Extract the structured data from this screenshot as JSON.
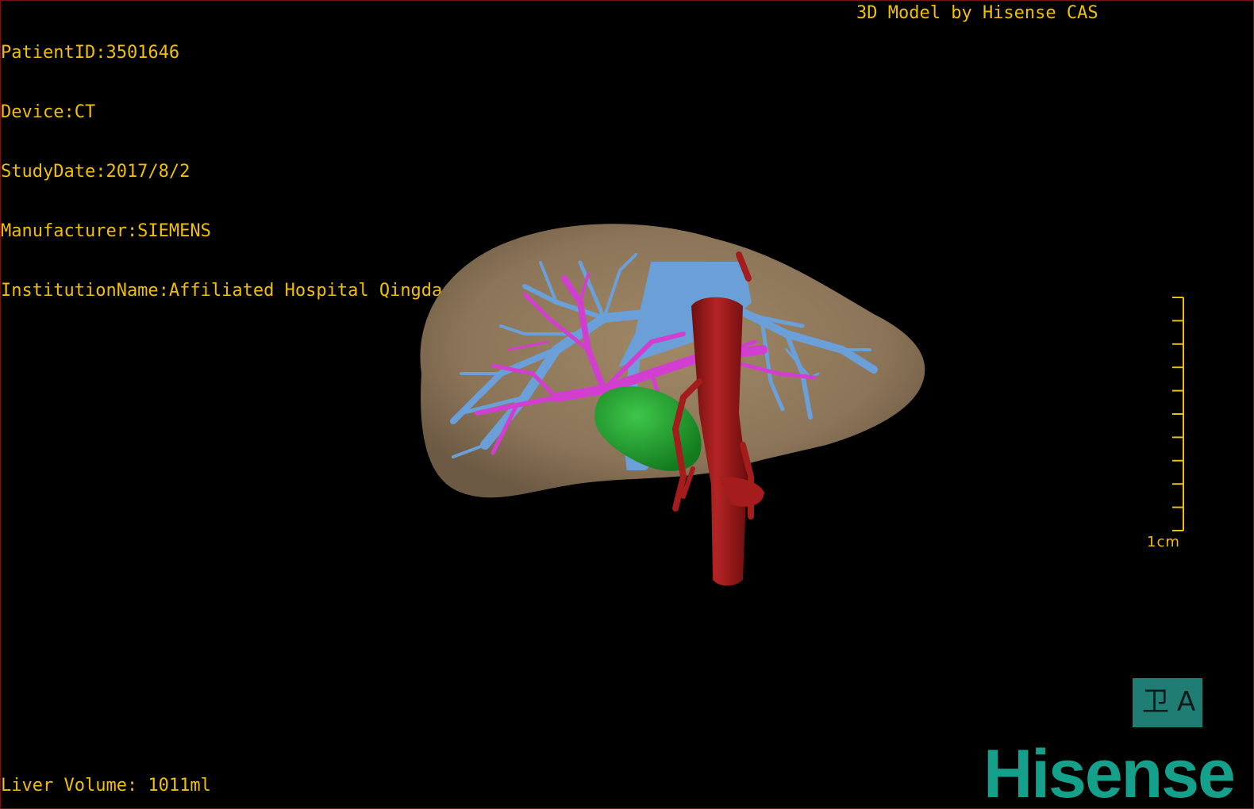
{
  "patient": {
    "lines": [
      "PatientID:3501646",
      "Device:CT",
      "StudyDate:2017/8/2",
      "Manufacturer:SIEMENS",
      "InstitutionName:Affiliated Hospital Qingdao University-C"
    ]
  },
  "header": {
    "brand_caption": "3D Model by Hisense CAS"
  },
  "footer": {
    "liver_volume": "Liver Volume: 1011ml"
  },
  "scale_bar": {
    "label": "1cm",
    "tick_count": 10
  },
  "view_badge": {
    "left_glyph": "卫",
    "right_glyph": "A"
  },
  "logo": {
    "text": "Hisense"
  },
  "colors": {
    "overlay_text": "#f0c000",
    "liver": "#8b7458",
    "hepatic_vein": "#6a9fd8",
    "portal_vein": "#d23fd0",
    "vena_cava": "#a41c1c",
    "gallbladder": "#1e9c2a",
    "brand": "#14a08a"
  },
  "icons": {
    "view_badge": "orientation-cube-icon"
  }
}
